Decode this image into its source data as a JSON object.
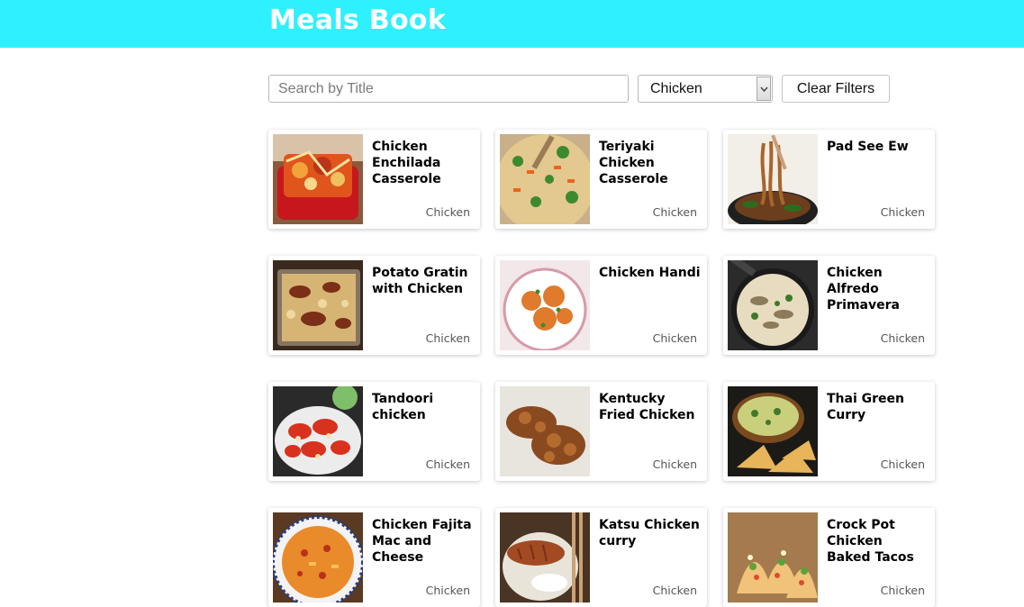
{
  "header": {
    "title": "Meals Book",
    "background": "#2ff0ff"
  },
  "filters": {
    "search_placeholder": "Search by Title",
    "search_value": "",
    "category_selected": "Chicken",
    "clear_label": "Clear Filters"
  },
  "meals": [
    {
      "title": "Chicken Enchilada Casserole",
      "category": "Chicken",
      "photo": "red-dish"
    },
    {
      "title": "Teriyaki Chicken Casserole",
      "category": "Chicken",
      "photo": "rice-mix"
    },
    {
      "title": "Pad See Ew",
      "category": "Chicken",
      "photo": "noodles"
    },
    {
      "title": "Potato Gratin with Chicken",
      "category": "Chicken",
      "photo": "gratin"
    },
    {
      "title": "Chicken Handi",
      "category": "Chicken",
      "photo": "curry-plate"
    },
    {
      "title": "Chicken Alfredo Primavera",
      "category": "Chicken",
      "photo": "pan-pasta"
    },
    {
      "title": "Tandoori chicken",
      "category": "Chicken",
      "photo": "tandoori"
    },
    {
      "title": "Kentucky Fried Chicken",
      "category": "Chicken",
      "photo": "fried"
    },
    {
      "title": "Thai Green Curry",
      "category": "Chicken",
      "photo": "green-curry"
    },
    {
      "title": "Chicken Fajita Mac and Cheese",
      "category": "Chicken",
      "photo": "mac"
    },
    {
      "title": "Katsu Chicken curry",
      "category": "Chicken",
      "photo": "katsu"
    },
    {
      "title": "Crock Pot Chicken Baked Tacos",
      "category": "Chicken",
      "photo": "tacos"
    }
  ]
}
